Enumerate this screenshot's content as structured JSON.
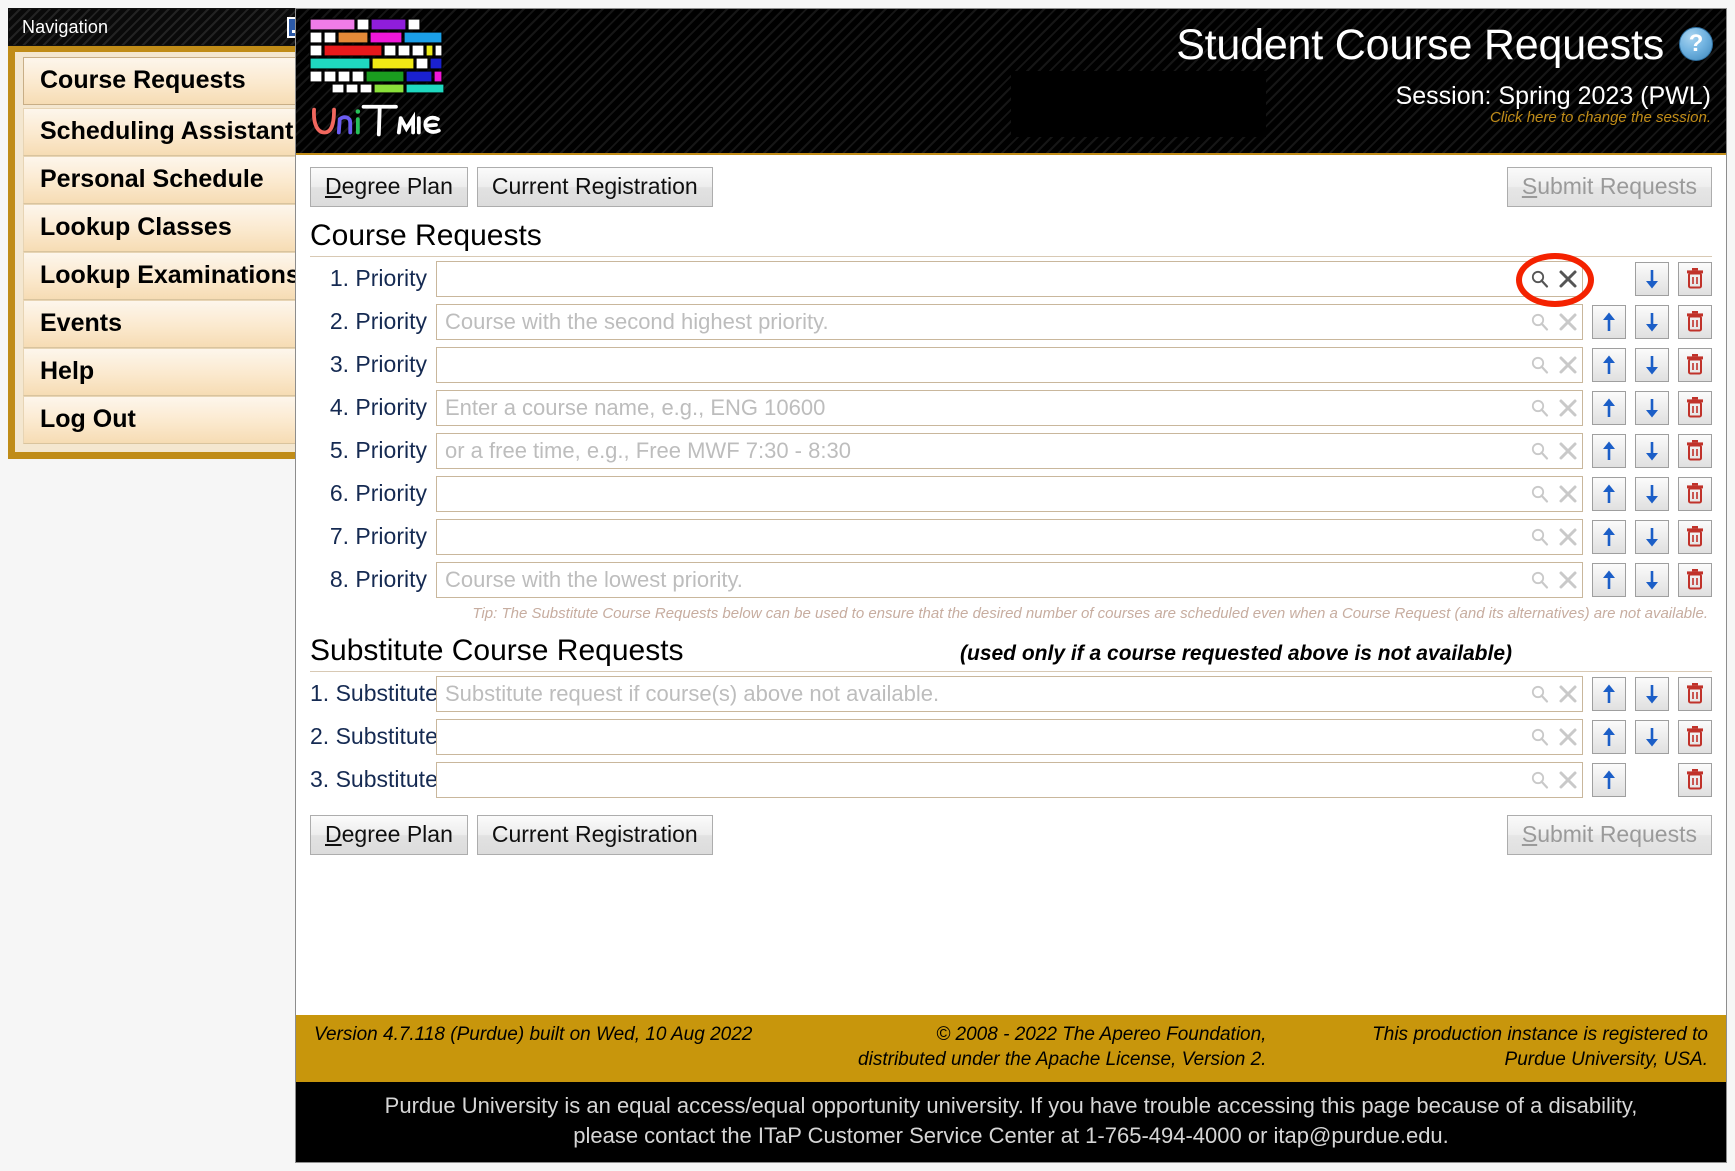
{
  "navigation": {
    "title": "Navigation",
    "minimize_icon": "minimize-icon",
    "items": [
      {
        "label": "Course Requests",
        "selected": true
      },
      {
        "label": "Scheduling Assistant"
      },
      {
        "label": "Personal Schedule"
      },
      {
        "label": "Lookup Classes"
      },
      {
        "label": "Lookup Examinations"
      },
      {
        "label": "Events"
      },
      {
        "label": "Help"
      },
      {
        "label": "Log Out"
      }
    ]
  },
  "header": {
    "logo_alt": "UniTime",
    "logo_word": "UniTime",
    "title": "Student Course Requests",
    "help_icon": "?",
    "session": "Session: Spring 2023 (PWL)",
    "session_change": "Click here to change the session.",
    "accent_color": "#c08c18"
  },
  "toolbar": {
    "degree_plan": "Degree Plan",
    "degree_plan_accesskey": "D",
    "current_registration": "Current Registration",
    "submit_requests": "Submit Requests",
    "submit_requests_accesskey": "S",
    "submit_disabled": true
  },
  "course_requests": {
    "heading": "Course Requests",
    "rows": [
      {
        "label": "1. Priority",
        "value": "",
        "placeholder": "",
        "up": false,
        "down": true,
        "delete": true
      },
      {
        "label": "2. Priority",
        "value": "",
        "placeholder": "Course with the second highest priority.",
        "up": true,
        "down": true,
        "delete": true
      },
      {
        "label": "3. Priority",
        "value": "",
        "placeholder": "",
        "up": true,
        "down": true,
        "delete": true
      },
      {
        "label": "4. Priority",
        "value": "",
        "placeholder": "Enter a course name, e.g., ENG 10600",
        "up": true,
        "down": true,
        "delete": true
      },
      {
        "label": "5. Priority",
        "value": "",
        "placeholder": "or a free time, e.g., Free MWF 7:30 - 8:30",
        "up": true,
        "down": true,
        "delete": true
      },
      {
        "label": "6. Priority",
        "value": "",
        "placeholder": "",
        "up": true,
        "down": true,
        "delete": true
      },
      {
        "label": "7. Priority",
        "value": "",
        "placeholder": "",
        "up": true,
        "down": true,
        "delete": true
      },
      {
        "label": "8. Priority",
        "value": "",
        "placeholder": "Course with the lowest priority.",
        "up": true,
        "down": true,
        "delete": true
      }
    ],
    "tip": "Tip: The Substitute Course Requests below can be used to ensure that the desired number of courses are scheduled even when a Course Request (and its alternatives) are not available."
  },
  "substitute_requests": {
    "heading": "Substitute Course Requests",
    "note": "(used only if a course requested above is not available)",
    "rows": [
      {
        "label": "1. Substitute",
        "value": "",
        "placeholder": "Substitute request if course(s) above not available.",
        "up": true,
        "down": true,
        "delete": true
      },
      {
        "label": "2. Substitute",
        "value": "",
        "placeholder": "",
        "up": true,
        "down": true,
        "delete": true
      },
      {
        "label": "3. Substitute",
        "value": "",
        "placeholder": "",
        "up": true,
        "down": false,
        "delete": true
      }
    ]
  },
  "row_icons": {
    "search": "search-icon",
    "clear": "clear-icon",
    "move_up": "arrow-up-icon",
    "move_down": "arrow-down-icon",
    "delete": "trash-icon"
  },
  "annotation": {
    "type": "ellipse-highlight",
    "color": "#f42200",
    "target": "course-request-row-1 search and clear icons"
  },
  "gold_footer": {
    "version": "Version 4.7.118 (Purdue) built on Wed, 10 Aug 2022",
    "copyright_line1": "© 2008 - 2022 The Apereo Foundation,",
    "copyright_line2": "distributed under the Apache License, Version 2.",
    "registered_line1": "This production instance is registered to",
    "registered_line2": "Purdue University, USA.",
    "background": "#c8960c"
  },
  "black_footer": {
    "line1": "Purdue University is an equal access/equal opportunity university. If you have trouble accessing this page because of a disability,",
    "line2": "please contact the ITaP Customer Service Center at 1-765-494-4000 or itap@purdue.edu."
  }
}
